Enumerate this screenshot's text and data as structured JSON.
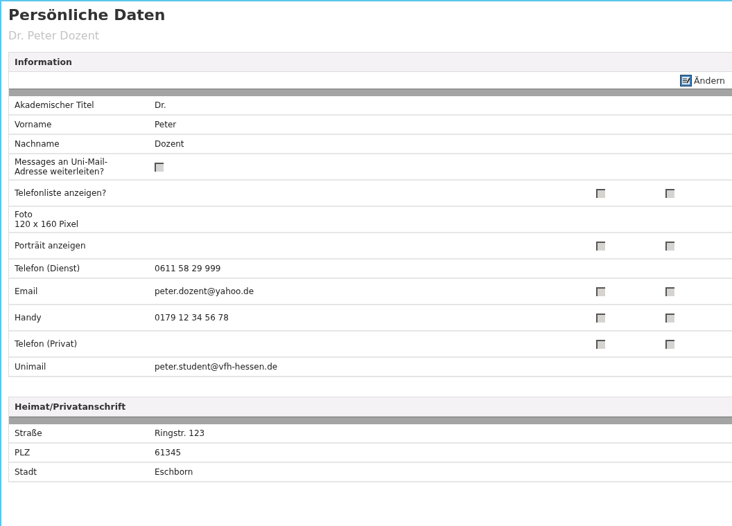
{
  "title": "Persönliche Daten",
  "subtitle": "Dr. Peter Dozent",
  "sections": [
    {
      "heading": "Information",
      "action": {
        "label": "Ändern"
      },
      "rows": [
        {
          "label": "Akademischer Titel",
          "value": "Dr."
        },
        {
          "label": "Vorname",
          "value": "Peter"
        },
        {
          "label": "Nachname",
          "value": "Dozent"
        },
        {
          "label": "Messages an Uni-Mail-Adresse weiterleiten?",
          "checkbox": {
            "checked": false,
            "disabled": true
          }
        },
        {
          "label": "Telefonliste anzeigen?",
          "flags": [
            {
              "checked": false,
              "disabled": true
            },
            {
              "checked": false,
              "disabled": true
            }
          ]
        },
        {
          "label": "Foto",
          "sublabel": "120 x 160 Pixel"
        },
        {
          "label": "Porträit anzeigen",
          "flags": [
            {
              "checked": false,
              "disabled": true
            },
            {
              "checked": false,
              "disabled": true
            }
          ]
        },
        {
          "label": "Telefon (Dienst)",
          "value": "0611 58 29 999"
        },
        {
          "label": "Email",
          "value": "peter.dozent@yahoo.de",
          "flags": [
            {
              "checked": false,
              "disabled": true
            },
            {
              "checked": false,
              "disabled": true
            }
          ]
        },
        {
          "label": "Handy",
          "value": "0179 12 34 56 78",
          "flags": [
            {
              "checked": false,
              "disabled": true
            },
            {
              "checked": false,
              "disabled": true
            }
          ]
        },
        {
          "label": "Telefon (Privat)",
          "flags": [
            {
              "checked": false,
              "disabled": true
            },
            {
              "checked": false,
              "disabled": true
            }
          ]
        },
        {
          "label": "Unimail",
          "value": "peter.student@vfh-hessen.de"
        }
      ]
    },
    {
      "heading": "Heimat/Privatanschrift",
      "rows": [
        {
          "label": "Straße",
          "value": "Ringstr. 123"
        },
        {
          "label": "PLZ",
          "value": "61345"
        },
        {
          "label": "Stadt",
          "value": "Eschborn"
        }
      ]
    }
  ]
}
